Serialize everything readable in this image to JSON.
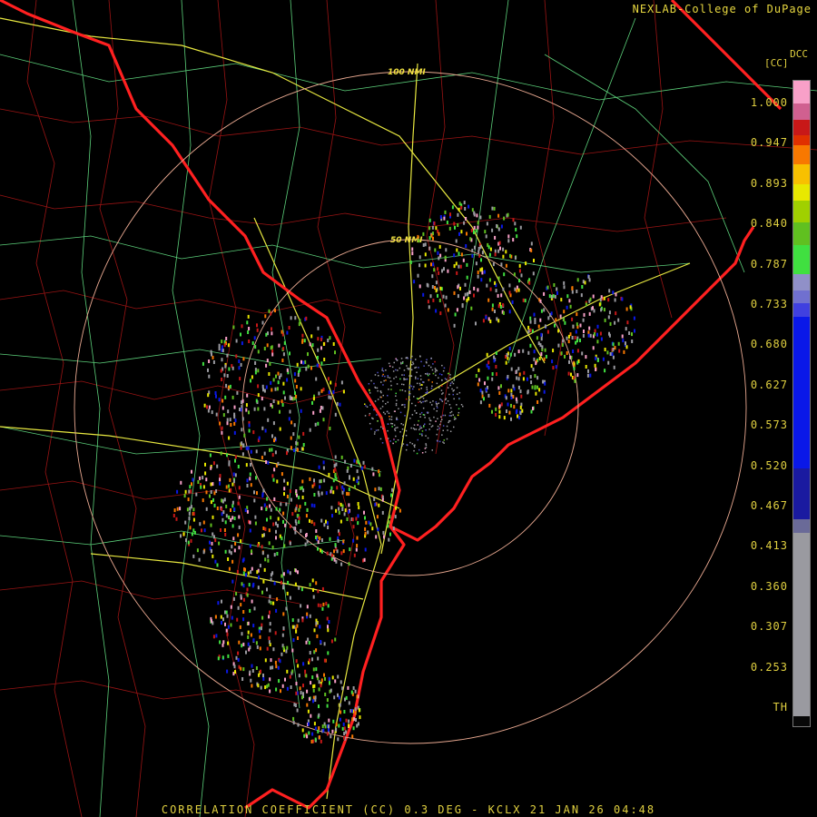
{
  "credit": "NEXLAB-College of DuPage",
  "product_code": "DCC",
  "unit_label": "[CC]",
  "footer": "CORRELATION COEFFICIENT (CC) 0.3 DEG - KCLX 21 JAN 26 04:48",
  "range_rings": [
    {
      "label": "50 NMI",
      "radius_nmi": 50
    },
    {
      "label": "100 NMI",
      "radius_nmi": 100
    }
  ],
  "colorbar": {
    "ticks": [
      "1.000",
      "0.947",
      "0.893",
      "0.840",
      "0.787",
      "0.733",
      "0.680",
      "0.627",
      "0.573",
      "0.520",
      "0.467",
      "0.413",
      "0.360",
      "0.307",
      "0.253",
      "TH"
    ],
    "stops": [
      {
        "from": 0.0,
        "to": 0.035,
        "color": "#f8a0c8"
      },
      {
        "from": 0.035,
        "to": 0.06,
        "color": "#d06090"
      },
      {
        "from": 0.06,
        "to": 0.085,
        "color": "#c81818"
      },
      {
        "from": 0.085,
        "to": 0.1,
        "color": "#e03000"
      },
      {
        "from": 0.1,
        "to": 0.13,
        "color": "#f87800"
      },
      {
        "from": 0.13,
        "to": 0.16,
        "color": "#f8c000"
      },
      {
        "from": 0.16,
        "to": 0.185,
        "color": "#e8e800"
      },
      {
        "from": 0.185,
        "to": 0.22,
        "color": "#a0d000"
      },
      {
        "from": 0.22,
        "to": 0.255,
        "color": "#60c020"
      },
      {
        "from": 0.255,
        "to": 0.3,
        "color": "#40e040"
      },
      {
        "from": 0.3,
        "to": 0.325,
        "color": "#9090c8"
      },
      {
        "from": 0.325,
        "to": 0.345,
        "color": "#7070d0"
      },
      {
        "from": 0.345,
        "to": 0.365,
        "color": "#4040e0"
      },
      {
        "from": 0.365,
        "to": 0.6,
        "color": "#0a18e8"
      },
      {
        "from": 0.6,
        "to": 0.68,
        "color": "#1a1aa0"
      },
      {
        "from": 0.68,
        "to": 0.7,
        "color": "#6a6a98"
      },
      {
        "from": 0.7,
        "to": 0.985,
        "color": "#9a9aa0"
      },
      {
        "from": 0.985,
        "to": 1.0,
        "color": "#080808"
      }
    ]
  },
  "colors": {
    "background": "#000000",
    "state_border": "#ff2020",
    "county_lines": "#9a1414",
    "roads_major": "#e8e840",
    "roads_minor": "#5cd07a",
    "range_ring": "#e8a890",
    "labels": "#e0d040"
  }
}
